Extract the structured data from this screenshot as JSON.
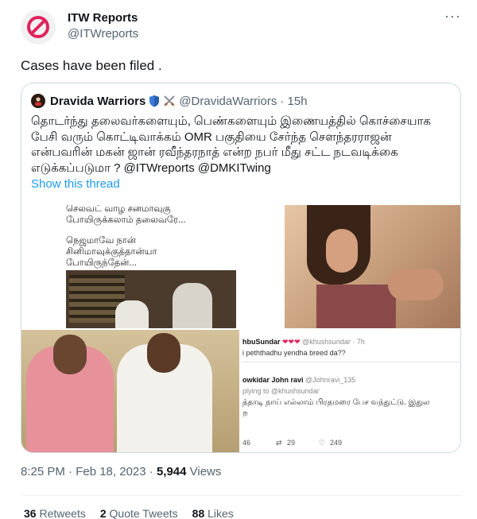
{
  "tweet": {
    "author_name": "ITW Reports",
    "author_handle": "@ITWreports",
    "more_icon": "more-horizontal-icon",
    "text": "Cases have been filed .",
    "timestamp": "8:25 PM · Feb 18, 2023 · ",
    "views_count": "5,944",
    "views_label": " Views"
  },
  "quote": {
    "author_name": "Dravida Warriors",
    "author_handle": "@DravidaWarriors",
    "time": "· 15h",
    "text": "தொடர்ந்து தலைவர்களையும், பெண்களையும் இணையத்தில் கொச்சையாக பேசி வரும் கொட்டிவாக்கம் OMR பகுதியை சேர்ந்த சௌந்தரராஜன் என்பவரின் மகன் ஜான் ரவீந்தரநாத் என்ற நபர் மீது சட்ட நடவடிக்கை எடுக்கப்படுமா ? @ITWreports @DMKITwing",
    "show_thread": "Show this thread"
  },
  "media": {
    "meme_caption_1": "செலவட் வாழ சனமாவுகு",
    "meme_caption_2": "போயிருக்கலாம் தலைவரே...",
    "meme_caption_3": "நெஜமாவே நான்",
    "meme_caption_4": "சினிமாவுக்குத்தான்யா",
    "meme_caption_5": "போயிருந்தேன்...",
    "screenshot": {
      "name1": "hbuSundar",
      "hearts": "❤❤❤",
      "handle1": "@khushsundar · 7h",
      "text1": "i peththadhu yendha breed da??",
      "name2": "owkidar John ravi",
      "handle2": "@Johnravi_135",
      "reply_to": "plying to @khushsundar",
      "text2": "த்தாடி நாய் எல்லாம் பிரதமரை பேச வந்துட்டு. இதுல",
      "text2b": "ற",
      "stat_replies": "46",
      "stat_retweets": "29",
      "stat_likes": "249"
    }
  },
  "engagement": {
    "retweets_count": "36",
    "retweets_label": "Retweets",
    "quotes_count": "2",
    "quotes_label": "Quote Tweets",
    "likes_count": "88",
    "likes_label": "Likes"
  },
  "colors": {
    "accent": "#1d9bf0",
    "logo_red": "#e0245e",
    "text_secondary": "#536471"
  }
}
